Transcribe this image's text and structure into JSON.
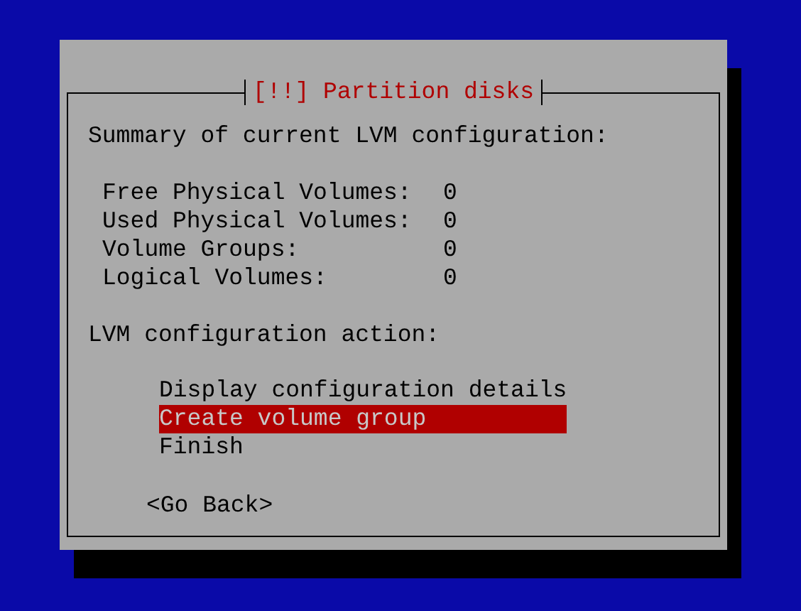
{
  "dialog": {
    "title": "[!!] Partition disks"
  },
  "summary": {
    "heading": "Summary of current LVM configuration:",
    "rows": [
      {
        "label": "Free Physical Volumes:",
        "value": "0"
      },
      {
        "label": "Used Physical Volumes:",
        "value": "0"
      },
      {
        "label": "Volume Groups:",
        "value": "0"
      },
      {
        "label": "Logical Volumes:",
        "value": "0"
      }
    ]
  },
  "action_heading": "LVM configuration action:",
  "menu": {
    "items": [
      {
        "label": "Display configuration details",
        "selected": false
      },
      {
        "label": "Create volume group",
        "selected": true
      },
      {
        "label": "Finish",
        "selected": false
      }
    ]
  },
  "back_button": "<Go Back>"
}
